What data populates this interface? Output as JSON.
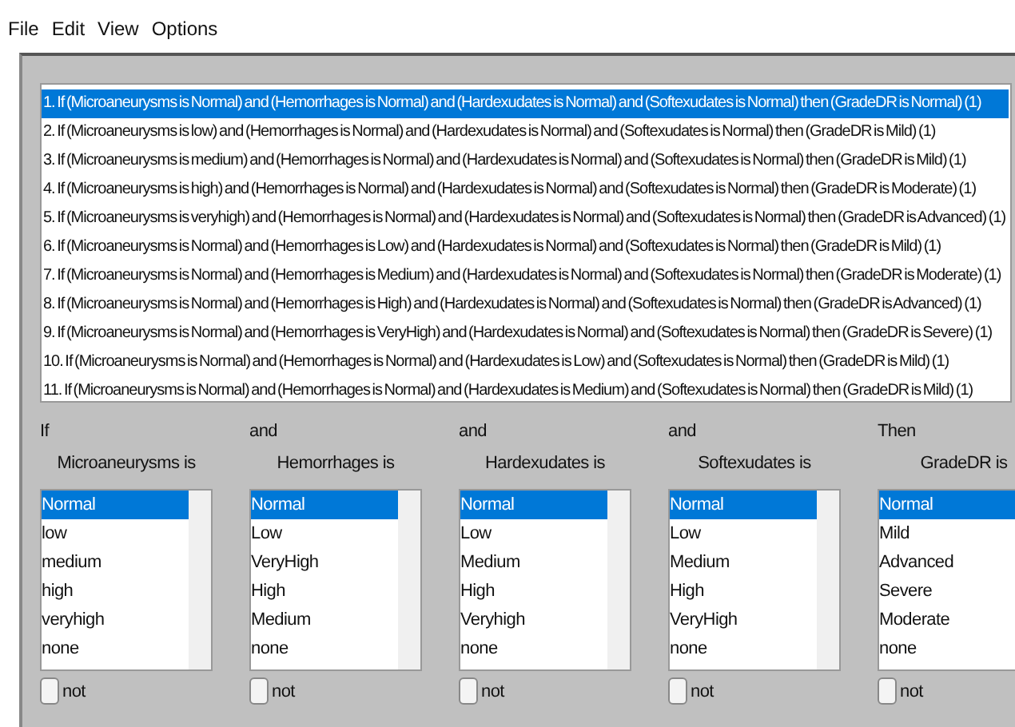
{
  "menu": [
    "File",
    "Edit",
    "View",
    "Options"
  ],
  "rules": [
    {
      "text": "1. If (Microaneurysms is Normal) and (Hemorrhages is Normal) and (Hardexudates is Normal) and (Softexudates is Normal) then (GradeDR is Normal) (1)",
      "selected": true
    },
    {
      "text": "2. If (Microaneurysms is low) and (Hemorrhages is Normal) and (Hardexudates is Normal) and (Softexudates is Normal) then (GradeDR is Mild) (1)",
      "selected": false
    },
    {
      "text": "3. If (Microaneurysms is medium) and (Hemorrhages is Normal) and (Hardexudates is Normal) and (Softexudates is Normal) then (GradeDR is Mild) (1)",
      "selected": false
    },
    {
      "text": "4. If (Microaneurysms is high) and (Hemorrhages is Normal) and (Hardexudates is Normal) and (Softexudates is Normal) then (GradeDR is Moderate) (1)",
      "selected": false
    },
    {
      "text": "5. If (Microaneurysms is veryhigh) and (Hemorrhages is Normal) and (Hardexudates is Normal) and (Softexudates is Normal) then (GradeDR is Advanced) (1)",
      "selected": false
    },
    {
      "text": "6. If (Microaneurysms is Normal) and (Hemorrhages is Low) and (Hardexudates is Normal) and (Softexudates is Normal) then (GradeDR is Mild) (1)",
      "selected": false
    },
    {
      "text": "7. If (Microaneurysms is Normal) and (Hemorrhages is Medium) and (Hardexudates is Normal) and (Softexudates is Normal) then (GradeDR is Moderate) (1)",
      "selected": false
    },
    {
      "text": "8. If (Microaneurysms is Normal) and (Hemorrhages is High) and (Hardexudates is Normal) and (Softexudates is Normal) then (GradeDR is Advanced) (1)",
      "selected": false
    },
    {
      "text": "9. If (Microaneurysms is Normal) and (Hemorrhages is VeryHigh) and (Hardexudates is Normal) and (Softexudates is Normal) then (GradeDR is Severe) (1)",
      "selected": false
    },
    {
      "text": "10. If (Microaneurysms is Normal) and (Hemorrhages is Normal) and (Hardexudates is Low) and (Softexudates is Normal) then (GradeDR is Mild) (1)",
      "selected": false
    },
    {
      "text": "11. If (Microaneurysms is Normal) and (Hemorrhages is Normal) and (Hardexudates is Medium) and (Softexudates is Normal) then (GradeDR is Mild) (1)",
      "selected": false
    }
  ],
  "columns": [
    {
      "connector": "If",
      "variable": "Microaneurysms is",
      "options": [
        {
          "label": "Normal",
          "selected": true
        },
        {
          "label": "low",
          "selected": false
        },
        {
          "label": "medium",
          "selected": false
        },
        {
          "label": "high",
          "selected": false
        },
        {
          "label": "veryhigh",
          "selected": false
        },
        {
          "label": "none",
          "selected": false
        }
      ],
      "not_label": "not",
      "not_checked": false
    },
    {
      "connector": "and",
      "variable": "Hemorrhages is",
      "options": [
        {
          "label": "Normal",
          "selected": true
        },
        {
          "label": "Low",
          "selected": false
        },
        {
          "label": "VeryHigh",
          "selected": false
        },
        {
          "label": "High",
          "selected": false
        },
        {
          "label": "Medium",
          "selected": false
        },
        {
          "label": "none",
          "selected": false
        }
      ],
      "not_label": "not",
      "not_checked": false
    },
    {
      "connector": "and",
      "variable": "Hardexudates is",
      "options": [
        {
          "label": "Normal",
          "selected": true
        },
        {
          "label": "Low",
          "selected": false
        },
        {
          "label": "Medium",
          "selected": false
        },
        {
          "label": "High",
          "selected": false
        },
        {
          "label": "Veryhigh",
          "selected": false
        },
        {
          "label": "none",
          "selected": false
        }
      ],
      "not_label": "not",
      "not_checked": false
    },
    {
      "connector": "and",
      "variable": "Softexudates is",
      "options": [
        {
          "label": "Normal",
          "selected": true
        },
        {
          "label": "Low",
          "selected": false
        },
        {
          "label": "Medium",
          "selected": false
        },
        {
          "label": "High",
          "selected": false
        },
        {
          "label": "VeryHigh",
          "selected": false
        },
        {
          "label": "none",
          "selected": false
        }
      ],
      "not_label": "not",
      "not_checked": false
    },
    {
      "connector": "Then",
      "variable": "GradeDR is",
      "options": [
        {
          "label": "Normal",
          "selected": true
        },
        {
          "label": "Mild",
          "selected": false
        },
        {
          "label": "Advanced",
          "selected": false
        },
        {
          "label": "Severe",
          "selected": false
        },
        {
          "label": "Moderate",
          "selected": false
        },
        {
          "label": "none",
          "selected": false
        }
      ],
      "not_label": "not",
      "not_checked": false
    }
  ]
}
